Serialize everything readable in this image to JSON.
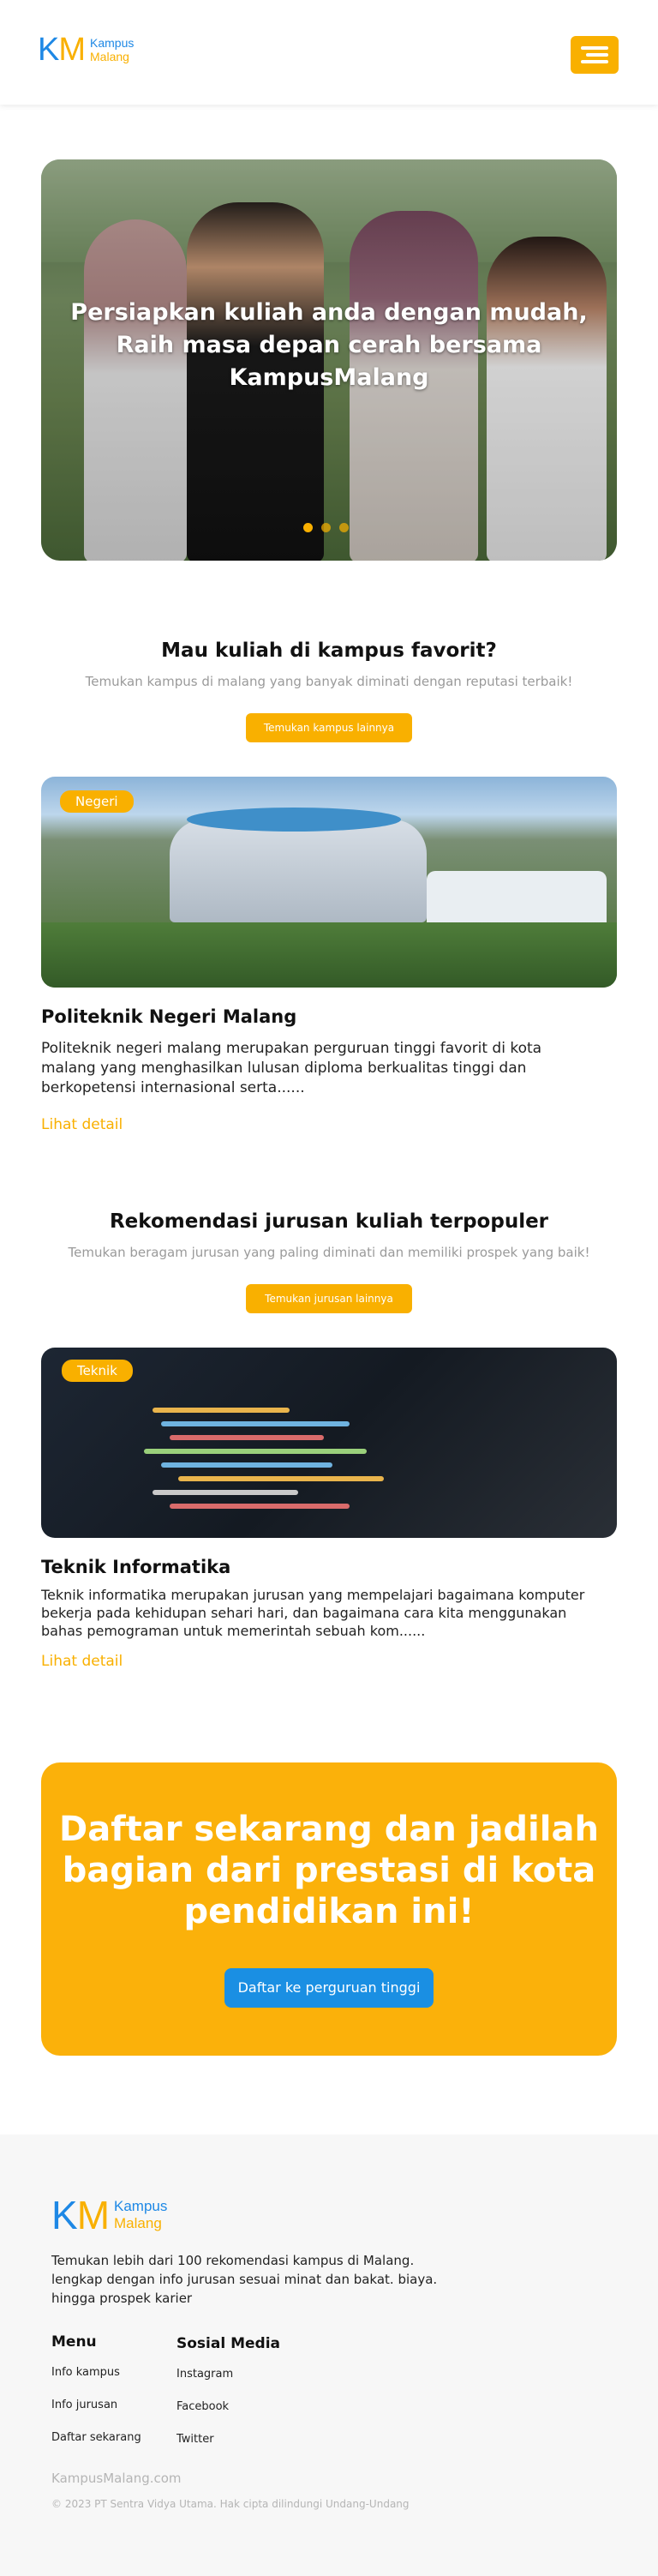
{
  "brand": {
    "mark_k": "K",
    "mark_m": "M",
    "name_line1": "Kampus",
    "name_line2": "Malang",
    "colors": {
      "primary": "#f9b000",
      "blue": "#1e88e5"
    }
  },
  "header": {
    "menu_icon": "hamburger-menu-icon"
  },
  "hero": {
    "title_part1": "Persiapkan kuliah",
    "title_part2": " anda dengan ",
    "title_part3": "mudah,",
    "title_line2_part1": "Raih ",
    "title_line2_part2": "masa depan",
    "title_line2_part3": " cerah bersama",
    "title_line3": "KampusMalang",
    "slides": 3,
    "active_slide": 1
  },
  "campus_section": {
    "title": "Mau kuliah di kampus favorit?",
    "subtitle": "Temukan kampus di malang yang banyak diminati dengan reputasi terbaik!",
    "button": "Temukan kampus lainnya",
    "card": {
      "tag": "Negeri",
      "title": "Politeknik Negeri Malang",
      "description": "Politeknik negeri malang merupakan perguruan tinggi favorit di kota malang yang menghasilkan lulusan diploma berkualitas tinggi dan berkopetensi internasional serta......",
      "link": "Lihat detail"
    }
  },
  "major_section": {
    "title": "Rekomendasi jurusan kuliah terpopuler",
    "subtitle": "Temukan beragam jurusan yang paling diminati dan memiliki prospek yang baik!",
    "button": "Temukan jurusan lainnya",
    "card": {
      "tag": "Teknik",
      "title": "Teknik Informatika",
      "description": "Teknik informatika merupakan jurusan yang mempelajari bagaimana komputer bekerja pada kehidupan sehari hari, dan bagaimana cara kita menggunakan bahas pemograman untuk memerintah sebuah kom......",
      "link": "Lihat detail"
    }
  },
  "cta": {
    "title": "Daftar sekarang dan jadilah bagian dari prestasi di kota pendidikan ini!",
    "button": "Daftar ke perguruan tinggi"
  },
  "footer": {
    "description": "Temukan lebih dari 100 rekomendasi kampus di Malang. lengkap dengan info jurusan sesuai minat dan bakat. biaya. hingga prospek karier",
    "menu_title": "Menu",
    "menu_items": [
      "Info kampus",
      "Info jurusan",
      "Daftar sekarang"
    ],
    "social_title": "Sosial Media",
    "social_items": [
      "Instagram",
      "Facebook",
      "Twitter"
    ],
    "site": "KampusMalang.com",
    "copyright": "© 2023 PT Sentra Vidya Utama. Hak cipta dilindungi Undang-Undang"
  }
}
